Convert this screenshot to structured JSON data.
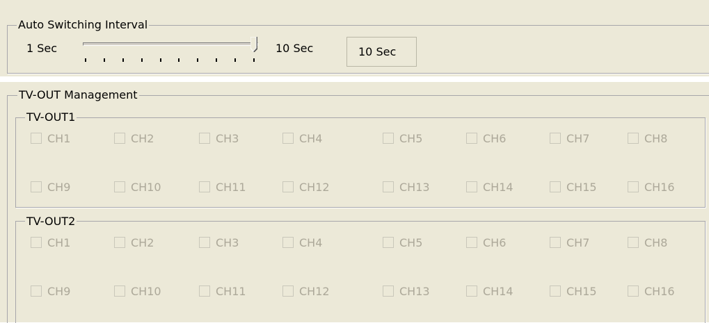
{
  "auto_switching": {
    "title": "Auto Switching Interval",
    "min_label": "1 Sec",
    "max_label": "10 Sec",
    "value_display": "10 Sec",
    "slider": {
      "min": 1,
      "max": 10,
      "value": 10,
      "ticks": 10
    }
  },
  "tv_out": {
    "title": "TV-OUT Management",
    "groups": [
      {
        "title": "TV-OUT1",
        "channels": [
          "CH1",
          "CH2",
          "CH3",
          "CH4",
          "CH5",
          "CH6",
          "CH7",
          "CH8",
          "CH9",
          "CH10",
          "CH11",
          "CH12",
          "CH13",
          "CH14",
          "CH15",
          "CH16"
        ],
        "checked": [
          false,
          false,
          false,
          false,
          false,
          false,
          false,
          false,
          false,
          false,
          false,
          false,
          false,
          false,
          false,
          false
        ],
        "enabled": false
      },
      {
        "title": "TV-OUT2",
        "channels": [
          "CH1",
          "CH2",
          "CH3",
          "CH4",
          "CH5",
          "CH6",
          "CH7",
          "CH8",
          "CH9",
          "CH10",
          "CH11",
          "CH12",
          "CH13",
          "CH14",
          "CH15",
          "CH16"
        ],
        "checked": [
          false,
          false,
          false,
          false,
          false,
          false,
          false,
          false,
          false,
          false,
          false,
          false,
          false,
          false,
          false,
          false
        ],
        "enabled": false
      }
    ]
  },
  "colors": {
    "face": "#ece9d8",
    "group_border": "#a7a6aa",
    "disabled_text": "#aca899",
    "disabled_box_border": "#c9c7ba"
  }
}
